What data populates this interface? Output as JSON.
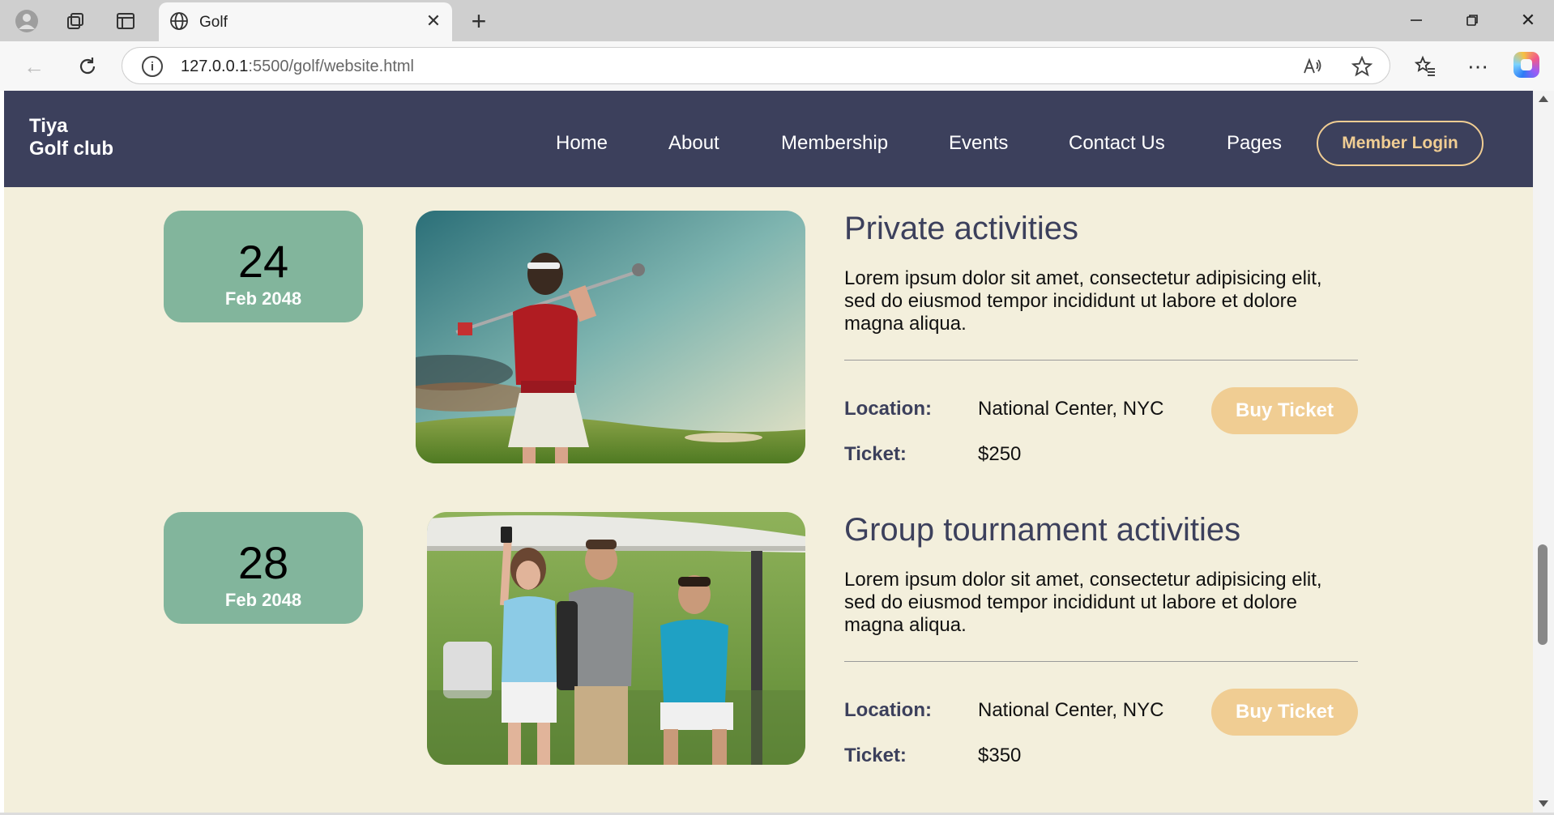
{
  "browser": {
    "tab_title": "Golf",
    "url_host": "127.0.0.1",
    "url_rest": ":5500/golf/website.html",
    "icons": [
      "profile-icon",
      "workspaces-icon",
      "tab-actions-icon",
      "globe-icon",
      "close-icon",
      "new-tab-icon",
      "minimize-icon",
      "restore-icon",
      "window-close-icon",
      "back-icon",
      "refresh-icon",
      "info-icon",
      "read-aloud-icon",
      "favorite-star-icon",
      "favorites-icon",
      "more-icon",
      "copilot-icon"
    ]
  },
  "site": {
    "logo_line1": "Tiya",
    "logo_line2": "Golf club",
    "nav": [
      "Home",
      "About",
      "Membership",
      "Events",
      "Contact Us",
      "Pages"
    ],
    "login_label": "Member Login"
  },
  "events": [
    {
      "day": "24",
      "month": "Feb 2048",
      "title": "Private activities",
      "desc": "Lorem ipsum dolor sit amet, consectetur adipisicing elit, sed do eiusmod tempor incididunt ut labore et dolore magna aliqua.",
      "location_label": "Location:",
      "location": "National Center, NYC",
      "ticket_label": "Ticket:",
      "ticket": "$250",
      "button": "Buy Ticket"
    },
    {
      "day": "28",
      "month": "Feb 2048",
      "title": "Group tournament activities",
      "desc": "Lorem ipsum dolor sit amet, consectetur adipisicing elit, sed do eiusmod tempor incididunt ut labore et dolore magna aliqua.",
      "location_label": "Location:",
      "location": "National Center, NYC",
      "ticket_label": "Ticket:",
      "ticket": "$350",
      "button": "Buy Ticket"
    }
  ],
  "colors": {
    "header_bg": "#3c405c",
    "page_bg": "#f3efdc",
    "date_card": "#82b59c",
    "accent": "#f0cd93"
  }
}
